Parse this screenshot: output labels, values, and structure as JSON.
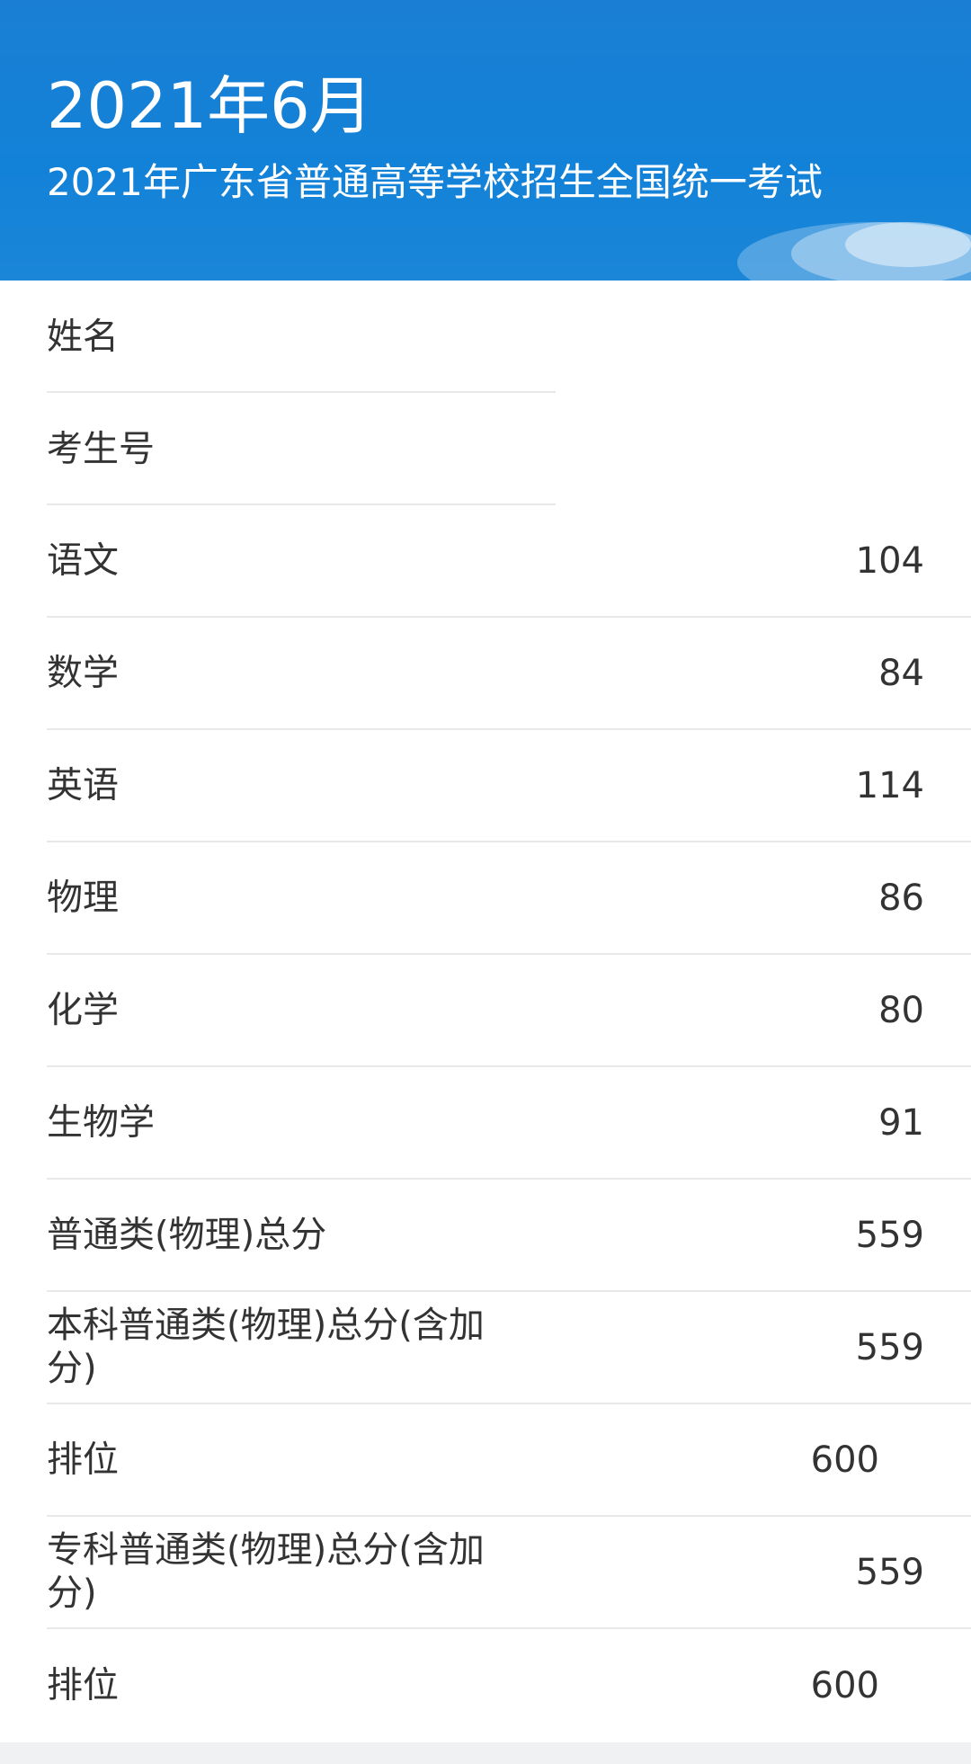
{
  "header": {
    "title": "2021年6月",
    "subtitle": "2021年广东省普通高等学校招生全国统一考试"
  },
  "identity": [
    {
      "label": "姓名",
      "value": ""
    },
    {
      "label": "考生号",
      "value": ""
    }
  ],
  "scores": [
    {
      "label": "语文",
      "value": "104"
    },
    {
      "label": "数学",
      "value": "84"
    },
    {
      "label": "英语",
      "value": "114"
    },
    {
      "label": "物理",
      "value": "86"
    },
    {
      "label": "化学",
      "value": "80"
    },
    {
      "label": "生物学",
      "value": "91"
    },
    {
      "label": "普通类(物理)总分",
      "value": "559"
    },
    {
      "label": "本科普通类(物理)总分(含加分)",
      "value": "559"
    },
    {
      "label": "排位",
      "value": "600"
    },
    {
      "label": "专科普通类(物理)总分(含加分)",
      "value": "559"
    },
    {
      "label": "排位",
      "value": "600"
    }
  ],
  "colors": {
    "header_bg": "#1282d8",
    "text": "#333333",
    "divider": "#e8e8e8"
  }
}
